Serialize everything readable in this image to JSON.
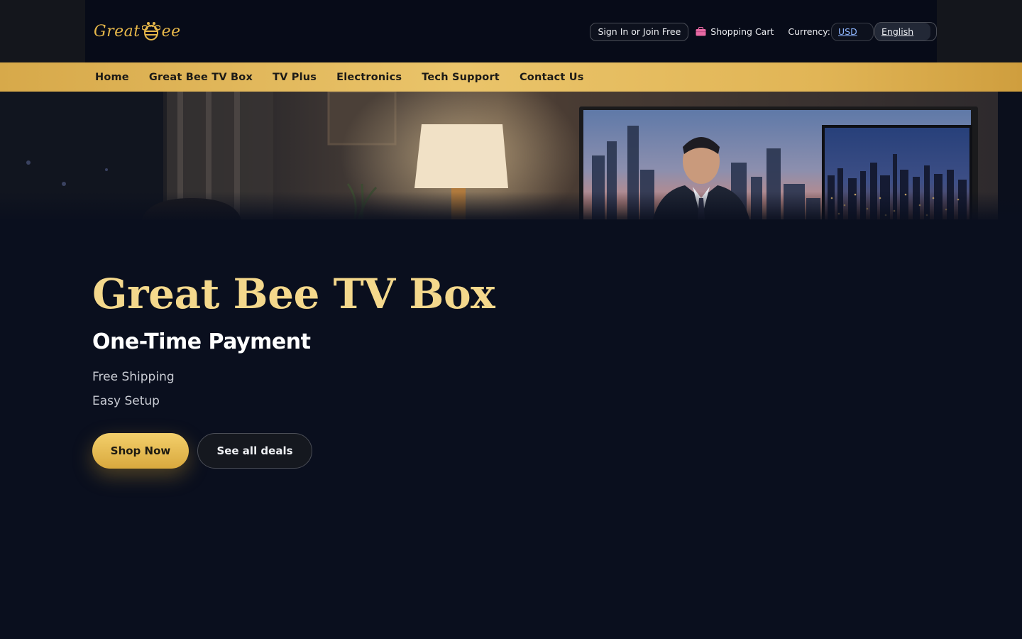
{
  "brand": {
    "logo_text_left": "Great",
    "logo_text_right": "ee"
  },
  "header": {
    "signin_label": "Sign In or Join Free",
    "cart_label": "Shopping Cart",
    "currency_label": "Currency:",
    "currency_value": "USD",
    "language_value": "English"
  },
  "nav": {
    "items": [
      "Home",
      "Great Bee TV Box",
      "TV Plus",
      "Electronics",
      "Tech Support",
      "Contact Us"
    ]
  },
  "hero": {
    "title": "Great Bee TV Box",
    "subtitle": "One-Time Payment",
    "features": [
      "Free Shipping",
      "Easy Setup"
    ],
    "primary_cta": "Shop Now",
    "secondary_cta": "See all deals"
  },
  "colors": {
    "background": "#0a0f1e",
    "accent_gold": "#e7b84a",
    "title_gold": "#f4d88c",
    "nav_gold": "#eac46a",
    "link_blue": "#8fb6ff"
  },
  "icons": [
    "bee-logo-icon",
    "shopping-bag-icon"
  ]
}
